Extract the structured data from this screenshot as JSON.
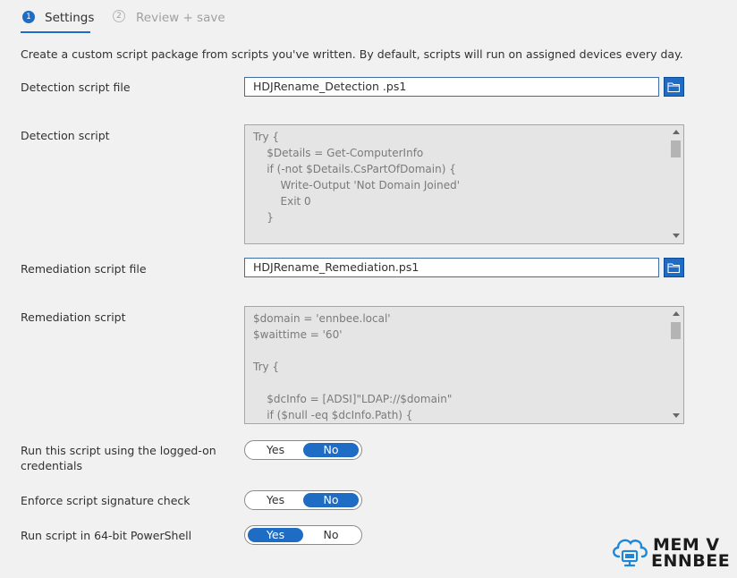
{
  "wizard": {
    "steps": [
      {
        "number": "1",
        "label": "Settings"
      },
      {
        "number": "2",
        "label": "Review + save"
      }
    ]
  },
  "description": "Create a custom script package from scripts you've written. By default, scripts will run on assigned devices every day.",
  "detection_file": {
    "label": "Detection script file",
    "value": "HDJRename_Detection .ps1"
  },
  "detection_script": {
    "label": "Detection script",
    "lines": [
      "Try {",
      "    $Details = Get-ComputerInfo",
      "    if (-not $Details.CsPartOfDomain) {",
      "        Write-Output 'Not Domain Joined'",
      "        Exit 0",
      "    }"
    ]
  },
  "remediation_file": {
    "label": "Remediation script file",
    "value": "HDJRename_Remediation.ps1"
  },
  "remediation_script": {
    "label": "Remediation script",
    "lines": [
      "$domain = 'ennbee.local'",
      "$waittime = '60'",
      "",
      "Try {",
      "",
      "    $dcInfo = [ADSI]\"LDAP://$domain\"",
      "    if ($null -eq $dcInfo.Path) {"
    ]
  },
  "options": [
    {
      "label": "Run this script using the logged-on credentials",
      "yes": "Yes",
      "no": "No",
      "selected": "No"
    },
    {
      "label": "Enforce script signature check",
      "yes": "Yes",
      "no": "No",
      "selected": "No"
    },
    {
      "label": "Run script in 64-bit PowerShell",
      "yes": "Yes",
      "no": "No",
      "selected": "Yes"
    }
  ],
  "logo": {
    "line1": "MEM V",
    "line2": "ENNBEE",
    "accent": "#1e88d8"
  },
  "colors": {
    "accent": "#1f6cc4",
    "script_bg": "#e5e5e5",
    "page_bg": "#f1f1f1"
  }
}
